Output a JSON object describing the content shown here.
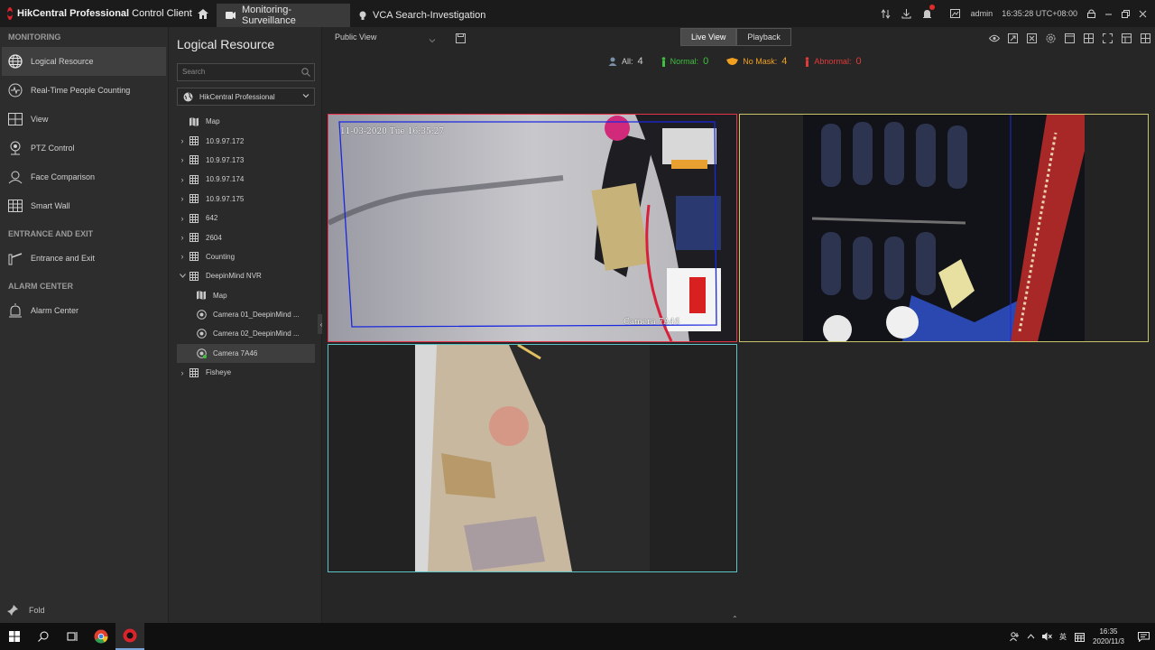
{
  "app": {
    "brand_bold": "HikCentral Professional",
    "brand_rest": " Control Client",
    "tabs": [
      {
        "label": "Monitoring-Surveillance",
        "active": true
      },
      {
        "label": "VCA Search-Investigation",
        "active": false
      }
    ],
    "user": "admin",
    "time": "16:35:28 UTC+08:00"
  },
  "nav": {
    "sections": [
      {
        "title": "MONITORING",
        "items": [
          "Logical Resource",
          "Real-Time People Counting",
          "View",
          "PTZ Control",
          "Face Comparison",
          "Smart Wall"
        ]
      },
      {
        "title": "ENTRANCE AND EXIT",
        "items": [
          "Entrance and Exit"
        ]
      },
      {
        "title": "ALARM CENTER",
        "items": [
          "Alarm Center"
        ]
      }
    ],
    "active_item": "Logical Resource",
    "fold_label": "Fold"
  },
  "resource": {
    "title": "Logical Resource",
    "search_placeholder": "Search",
    "site": "HikCentral Professional",
    "tree": [
      {
        "label": "Map",
        "type": "map",
        "level": 1
      },
      {
        "label": "10.9.97.172",
        "type": "area",
        "level": 0
      },
      {
        "label": "10.9.97.173",
        "type": "area",
        "level": 0
      },
      {
        "label": "10.9.97.174",
        "type": "area",
        "level": 0
      },
      {
        "label": "10.9.97.175",
        "type": "area",
        "level": 0
      },
      {
        "label": "642",
        "type": "area",
        "level": 0
      },
      {
        "label": "2604",
        "type": "area",
        "level": 0
      },
      {
        "label": "Counting",
        "type": "area",
        "level": 0
      },
      {
        "label": "DeepinMind NVR",
        "type": "area",
        "level": 0,
        "expanded": true
      },
      {
        "label": "Map",
        "type": "map",
        "level": 1
      },
      {
        "label": "Camera 01_DeepinMind ...",
        "type": "camera",
        "level": 1
      },
      {
        "label": "Camera 02_DeepinMind ...",
        "type": "camera",
        "level": 1
      },
      {
        "label": "Camera 7A46",
        "type": "camera",
        "level": 1,
        "selected": true
      },
      {
        "label": "Fisheye",
        "type": "area",
        "level": 0
      }
    ]
  },
  "main": {
    "view_name": "Public View",
    "modes": [
      {
        "label": "Live View",
        "active": true
      },
      {
        "label": "Playback",
        "active": false
      }
    ],
    "stats": {
      "all_label": "All:",
      "all_value": "4",
      "normal_label": "Normal:",
      "normal_value": "0",
      "nomask_label": "No Mask:",
      "nomask_value": "4",
      "abnormal_label": "Abnormal:",
      "abnormal_value": "0"
    },
    "tiles": [
      {
        "timestamp": "11-03-2020 Tue 16:35:27",
        "camera_label": "Camera 7A46",
        "border_color": "#e8324a"
      },
      {
        "border_color": "#c9c36a"
      },
      {
        "border_color": "#5fc4c8"
      }
    ]
  },
  "colors": {
    "accent_red": "#d9232d",
    "normal_green": "#3fbf3f",
    "nomask_orange": "#f0a020",
    "abnormal_red": "#e03a3a"
  },
  "taskbar": {
    "clock_time": "16:35",
    "clock_date": "2020/11/3",
    "lang": "英"
  }
}
